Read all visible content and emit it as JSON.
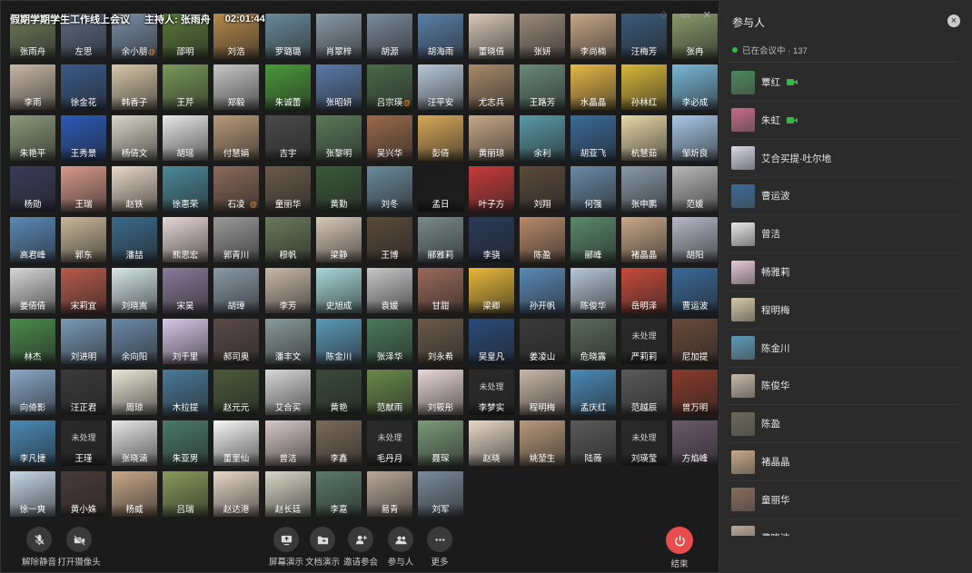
{
  "meeting": {
    "title": "假期学期学生工作线上会议",
    "host_label": "主持人: 张雨舟",
    "timer": "02:01:44"
  },
  "window_controls": [
    "♢",
    "▭",
    "✕"
  ],
  "participant_tiles": [
    {
      "name": "张雨舟",
      "color": "#6f7b5a"
    },
    {
      "name": "左思",
      "color": "#5b6b84"
    },
    {
      "name": "余小朋",
      "color": "#7a8fa8",
      "mark": "@"
    },
    {
      "name": "邵明",
      "color": "#5a7a3a"
    },
    {
      "name": "刘浩",
      "color": "#b88a4a"
    },
    {
      "name": "罗璐璐",
      "color": "#6a8a9a"
    },
    {
      "name": "肖翠梓",
      "color": "#8a9aa8"
    },
    {
      "name": "胡源",
      "color": "#7a8a9a"
    },
    {
      "name": "胡海雨",
      "color": "#5a7fa8"
    },
    {
      "name": "董晓倩",
      "color": "#d8c8b8"
    },
    {
      "name": "张妍",
      "color": "#9a8a7a"
    },
    {
      "name": "李尚楠",
      "color": "#c8a888"
    },
    {
      "name": "汪梅芳",
      "color": "#3a5a7a"
    },
    {
      "name": "张冉",
      "color": "#8a9a6a"
    },
    {
      "name": "李雨",
      "color": "#c8b8a8"
    },
    {
      "name": "徐金花",
      "color": "#3a5a8a"
    },
    {
      "name": "韩香子",
      "color": "#d8c8a8"
    },
    {
      "name": "王芹",
      "color": "#7a9a5a"
    },
    {
      "name": "郑毅",
      "color": "#c8c8c8"
    },
    {
      "name": "朱诚蕾",
      "color": "#4a9a3a"
    },
    {
      "name": "张昭妍",
      "color": "#5a7aa8"
    },
    {
      "name": "吕宗瑛",
      "color": "#4a6a4a",
      "mark": "@"
    },
    {
      "name": "汪平安",
      "color": "#b8c8d8"
    },
    {
      "name": "尤志兵",
      "color": "#a88a6a"
    },
    {
      "name": "王路芳",
      "color": "#6a8a7a"
    },
    {
      "name": "水晶晶",
      "color": "#e8b848"
    },
    {
      "name": "孙林红",
      "color": "#d8b838"
    },
    {
      "name": "李必成",
      "color": "#7ab8d8"
    },
    {
      "name": "朱艳平",
      "color": "#8a9a7a"
    },
    {
      "name": "王秀景",
      "color": "#2a5ab8"
    },
    {
      "name": "杨倩文",
      "color": "#d8d8c8"
    },
    {
      "name": "胡瑶",
      "color": "#e8e8e8"
    },
    {
      "name": "付慧娟",
      "color": "#b89a7a"
    },
    {
      "name": "吉宇",
      "color": "#4a4a4a"
    },
    {
      "name": "张黎明",
      "color": "#5a7a5a"
    },
    {
      "name": "吴兴华",
      "color": "#9a6a4a"
    },
    {
      "name": "彭倩",
      "color": "#d8a858"
    },
    {
      "name": "黄丽琼",
      "color": "#c8a888"
    },
    {
      "name": "余利",
      "color": "#5a9aa8"
    },
    {
      "name": "胡亚飞",
      "color": "#3a6a9a"
    },
    {
      "name": "杭慧茹",
      "color": "#e8d8a8"
    },
    {
      "name": "邹炘良",
      "color": "#a8c8e8"
    },
    {
      "name": "杨勋",
      "color": "#3a3a5a"
    },
    {
      "name": "王瑞",
      "color": "#d89a8a"
    },
    {
      "name": "赵铁",
      "color": "#e8d8c8"
    },
    {
      "name": "徐惠荣",
      "color": "#4a8a9a"
    },
    {
      "name": "石凌",
      "color": "#8a6a5a",
      "mark": "@"
    },
    {
      "name": "童丽华",
      "color": "#6a5a4a"
    },
    {
      "name": "黄勤",
      "color": "#3a5a3a"
    },
    {
      "name": "刘冬",
      "color": "#6a8a9a"
    },
    {
      "name": "孟日",
      "color": "#1a1a1a"
    },
    {
      "name": "叶子方",
      "color": "#c83a3a"
    },
    {
      "name": "刘翔",
      "color": "#5a4a3a"
    },
    {
      "name": "何强",
      "color": "#6a8aa8"
    },
    {
      "name": "张申鹏",
      "color": "#8a9aa8"
    },
    {
      "name": "范媛",
      "color": "#b8b8b8"
    },
    {
      "name": "高君峰",
      "color": "#5a8ab8"
    },
    {
      "name": "郭东",
      "color": "#c8b898"
    },
    {
      "name": "潘喆",
      "color": "#3a6a8a"
    },
    {
      "name": "熊思宏",
      "color": "#e8d8d8"
    },
    {
      "name": "郭青川",
      "color": "#9a9a9a"
    },
    {
      "name": "穆帆",
      "color": "#6a7a5a"
    },
    {
      "name": "梁静",
      "color": "#d8c8b8"
    },
    {
      "name": "王博",
      "color": "#5a4a3a"
    },
    {
      "name": "郦雅莉",
      "color": "#7a8a8a"
    },
    {
      "name": "李骁",
      "color": "#2a3a5a"
    },
    {
      "name": "陈盈",
      "color": "#b88a6a"
    },
    {
      "name": "郦峰",
      "color": "#5a8a6a"
    },
    {
      "name": "褚晶晶",
      "color": "#c8a888"
    },
    {
      "name": "胡阳",
      "color": "#b8b8c8"
    },
    {
      "name": "姜倩倩",
      "color": "#d8d8d8"
    },
    {
      "name": "宋莉宜",
      "color": "#b85a4a"
    },
    {
      "name": "刘晓嵩",
      "color": "#d8e8e8"
    },
    {
      "name": "宋昊",
      "color": "#8a7a9a"
    },
    {
      "name": "胡璋",
      "color": "#8a9aa8"
    },
    {
      "name": "李芳",
      "color": "#c8b8a8"
    },
    {
      "name": "史旭成",
      "color": "#a8d8d8"
    },
    {
      "name": "袁媛",
      "color": "#c8c8c8"
    },
    {
      "name": "甘甜",
      "color": "#9a6a5a"
    },
    {
      "name": "梁卿",
      "color": "#e8b838"
    },
    {
      "name": "孙开帆",
      "color": "#5a8ab8"
    },
    {
      "name": "陈俊华",
      "color": "#b8c8d8"
    },
    {
      "name": "岳明泽",
      "color": "#c84a3a"
    },
    {
      "name": "曹运波",
      "color": "#3a6a9a"
    },
    {
      "name": "林杰",
      "color": "#4a8a4a"
    },
    {
      "name": "刘进明",
      "color": "#7a9ab8"
    },
    {
      "name": "余向阳",
      "color": "#6a8aa8"
    },
    {
      "name": "刘千里",
      "color": "#d8c8e8"
    },
    {
      "name": "郝司奥",
      "color": "#5a4a4a"
    },
    {
      "name": "潘丰文",
      "color": "#8a9a9a"
    },
    {
      "name": "陈金川",
      "color": "#5a9ab8"
    },
    {
      "name": "张泽华",
      "color": "#4a7a5a"
    },
    {
      "name": "刘永希",
      "color": "#6a5a4a"
    },
    {
      "name": "吴皇凡",
      "color": "#2a4a7a"
    },
    {
      "name": "姜凌山",
      "color": "#3a3a3a"
    },
    {
      "name": "危晓露",
      "color": "#5a6a5a"
    },
    {
      "name": "严莉莉",
      "color": "#2a2a2a",
      "status": "未处理"
    },
    {
      "name": "尼加提",
      "color": "#6a4a3a"
    },
    {
      "name": "向倚影",
      "color": "#8aa8c8"
    },
    {
      "name": "汪正君",
      "color": "#3a3a3a"
    },
    {
      "name": "周琼",
      "color": "#e8e8d8"
    },
    {
      "name": "木拉提",
      "color": "#4a7a9a"
    },
    {
      "name": "赵元元",
      "color": "#4a5a3a"
    },
    {
      "name": "艾合买",
      "color": "#d8d8d8"
    },
    {
      "name": "黄艳",
      "color": "#3a4a3a"
    },
    {
      "name": "范献雨",
      "color": "#6a8a4a"
    },
    {
      "name": "刘筱彤",
      "color": "#e8d8d8"
    },
    {
      "name": "李梦实",
      "color": "#2a2a2a",
      "status": "未处理"
    },
    {
      "name": "程明梅",
      "color": "#c8b8a8"
    },
    {
      "name": "孟庆红",
      "color": "#4a8ab8"
    },
    {
      "name": "范越辰",
      "color": "#5a5a5a"
    },
    {
      "name": "曾万明",
      "color": "#8a3a2a"
    },
    {
      "name": "李凡捷",
      "color": "#4a8ab8"
    },
    {
      "name": "王瑾",
      "color": "#2a2a2a",
      "status": "未处理"
    },
    {
      "name": "张晓涵",
      "color": "#e8e8e8"
    },
    {
      "name": "朱亚男",
      "color": "#4a7a6a"
    },
    {
      "name": "董里仙",
      "color": "#f8f8f8"
    },
    {
      "name": "曾洁",
      "color": "#d8c8c8"
    },
    {
      "name": "李鑫",
      "color": "#7a6a5a"
    },
    {
      "name": "毛丹月",
      "color": "#2a2a2a",
      "status": "未处理"
    },
    {
      "name": "聂琛",
      "color": "#7a9a7a"
    },
    {
      "name": "赵晓",
      "color": "#e8d8c8"
    },
    {
      "name": "姚堃生",
      "color": "#b89a7a"
    },
    {
      "name": "陆薇",
      "color": "#5a5a5a"
    },
    {
      "name": "刘瑛莹",
      "color": "#2a2a2a",
      "status": "未处理"
    },
    {
      "name": "方焰峰",
      "color": "#6a5a6a"
    },
    {
      "name": "徐一爽",
      "color": "#c8d8e8"
    },
    {
      "name": "黄小姝",
      "color": "#4a3a3a"
    },
    {
      "name": "杨威",
      "color": "#c8a888"
    },
    {
      "name": "吕瑞",
      "color": "#8a9a5a"
    },
    {
      "name": "赵达港",
      "color": "#e8d8c8"
    },
    {
      "name": "赵长廷",
      "color": "#d8d8c8"
    },
    {
      "name": "李嘉",
      "color": "#5a7a6a"
    },
    {
      "name": "易青",
      "color": "#b8a898"
    },
    {
      "name": "刘军",
      "color": "#7a8a9a"
    }
  ],
  "controls": {
    "unmute": "解除静音",
    "camera": "打开摄像头",
    "screen_share": "屏幕演示",
    "doc_share": "文档演示",
    "invite": "邀请参会",
    "participants": "参与人",
    "more": "更多",
    "end": "结束"
  },
  "panel": {
    "title": "参与人",
    "status": "已在会议中 · 137",
    "participants": [
      {
        "name": "覃红",
        "color": "#4a8a5a",
        "camera": true
      },
      {
        "name": "朱虹",
        "color": "#c86a8a",
        "camera": true
      },
      {
        "name": "艾合买提·吐尔地",
        "color": "#d8d8e8",
        "camera": false
      },
      {
        "name": "曹运波",
        "color": "#3a6a9a",
        "camera": false
      },
      {
        "name": "曾洁",
        "color": "#e8e8e8",
        "camera": false
      },
      {
        "name": "畅雅莉",
        "color": "#e8c8d8",
        "camera": false
      },
      {
        "name": "程明梅",
        "color": "#d8c8a8",
        "camera": false
      },
      {
        "name": "陈金川",
        "color": "#5a9ab8",
        "camera": false
      },
      {
        "name": "陈俊华",
        "color": "#c8b8a8",
        "camera": false
      },
      {
        "name": "陈盈",
        "color": "#6a6a5a",
        "camera": false
      },
      {
        "name": "褚晶晶",
        "color": "#c8a888",
        "camera": false
      },
      {
        "name": "童丽华",
        "color": "#8a6a5a",
        "camera": false
      },
      {
        "name": "费晓洁",
        "color": "#b8a898",
        "camera": false
      }
    ]
  }
}
